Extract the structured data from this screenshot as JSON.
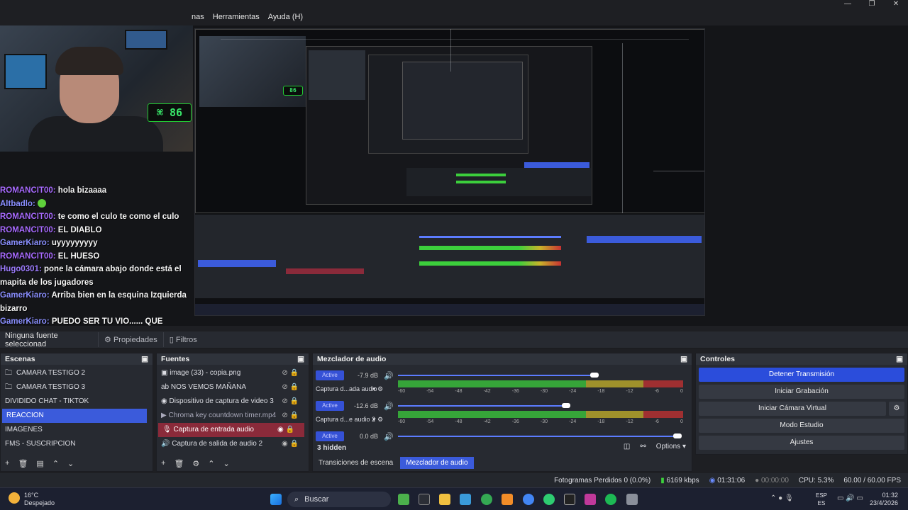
{
  "menu": {
    "items": [
      "nas",
      "Herramientas",
      "Ayuda (H)"
    ]
  },
  "window_controls": [
    "—",
    "❐",
    "✕"
  ],
  "webcam": {
    "clock": "86"
  },
  "chat": [
    {
      "user": "ROMANCIT00:",
      "msg": "hola bizaaaa"
    },
    {
      "user": "Altbadlo:",
      "msg": ""
    },
    {
      "user": "ROMANCIT00:",
      "msg": "te como el culo te como el culo"
    },
    {
      "user": "ROMANCIT00:",
      "msg": "EL DIABLO"
    },
    {
      "user": "GamerKiaro:",
      "msg": "uyyyyyyyyy"
    },
    {
      "user": "ROMANCIT00:",
      "msg": "EL HUESO"
    },
    {
      "user": "Hugo0301:",
      "msg": "pone la cámara abajo donde está el mapita de los jugadores"
    },
    {
      "user": "GamerKiaro:",
      "msg": "Arriba bien en la esquina Izquierda bizarro"
    },
    {
      "user": "GamerKiaro:",
      "msg": "PUEDO SER TU VIO...... QUE"
    }
  ],
  "props_bar": {
    "selected": "Ninguna fuente seleccionad",
    "properties": "Propiedades",
    "filters": "Filtros"
  },
  "scenes": {
    "title": "Escenas",
    "items": [
      "CAMARA TESTIGO 2",
      "CAMARA TESTIGO 3",
      "DIVIDIDO CHAT - TIKTOK",
      "REACCION",
      "IMAGENES",
      "FMS - SUSCRIPCION"
    ],
    "selected_index": 3
  },
  "sources": {
    "title": "Fuentes",
    "items": [
      "image (33) - copia.png",
      "NOS VEMOS MAÑANA",
      "Dispositivo de captura de video 3",
      "Chroma key countdown timer.mp4",
      "Captura de entrada audio",
      "Captura de salida de audio 2"
    ],
    "selected_index": 4
  },
  "mixer": {
    "title": "Mezclador de audio",
    "active_label": "Active",
    "channels": [
      {
        "name": "Captura d...ada audio",
        "db": "-7.9 dB",
        "level": 0.69
      },
      {
        "name": "Captura d...e audio 2",
        "db": "-12.6 dB",
        "level": 0.59
      },
      {
        "name": "",
        "db": "0.0 dB",
        "level": 0.98
      }
    ],
    "scale": [
      "-60",
      "-54",
      "-48",
      "-42",
      "-36",
      "-30",
      "-24",
      "-18",
      "-12",
      "-6",
      "0"
    ],
    "hidden": "3 hidden",
    "options": "Options",
    "tabs": [
      "Transiciones de escena",
      "Mezclador de audio"
    ]
  },
  "controls": {
    "title": "Controles",
    "buttons": [
      "Detener Transmisión",
      "Iniciar Grabación",
      "Iniciar Cámara Virtual",
      "Modo Estudio",
      "Ajustes"
    ]
  },
  "status": {
    "frames": "Fotogramas Perdidos 0 (0.0%)",
    "kbps": "6169 kbps",
    "live": "01:31:06",
    "rec": "00:00:00",
    "cpu": "CPU: 5.3%",
    "fps": "60.00 / 60.00 FPS"
  },
  "taskbar": {
    "weather_temp": "16°C",
    "weather_text": "Despejado",
    "search": "Buscar",
    "lang1": "ESP",
    "lang2": "ES",
    "time": "01:32",
    "date": "23/4/2026"
  },
  "colors": {
    "accent": "#3b5bdb",
    "meter_green": "#3ccf3c",
    "meter_yellow": "#c8b42a",
    "meter_red": "#c83232"
  }
}
